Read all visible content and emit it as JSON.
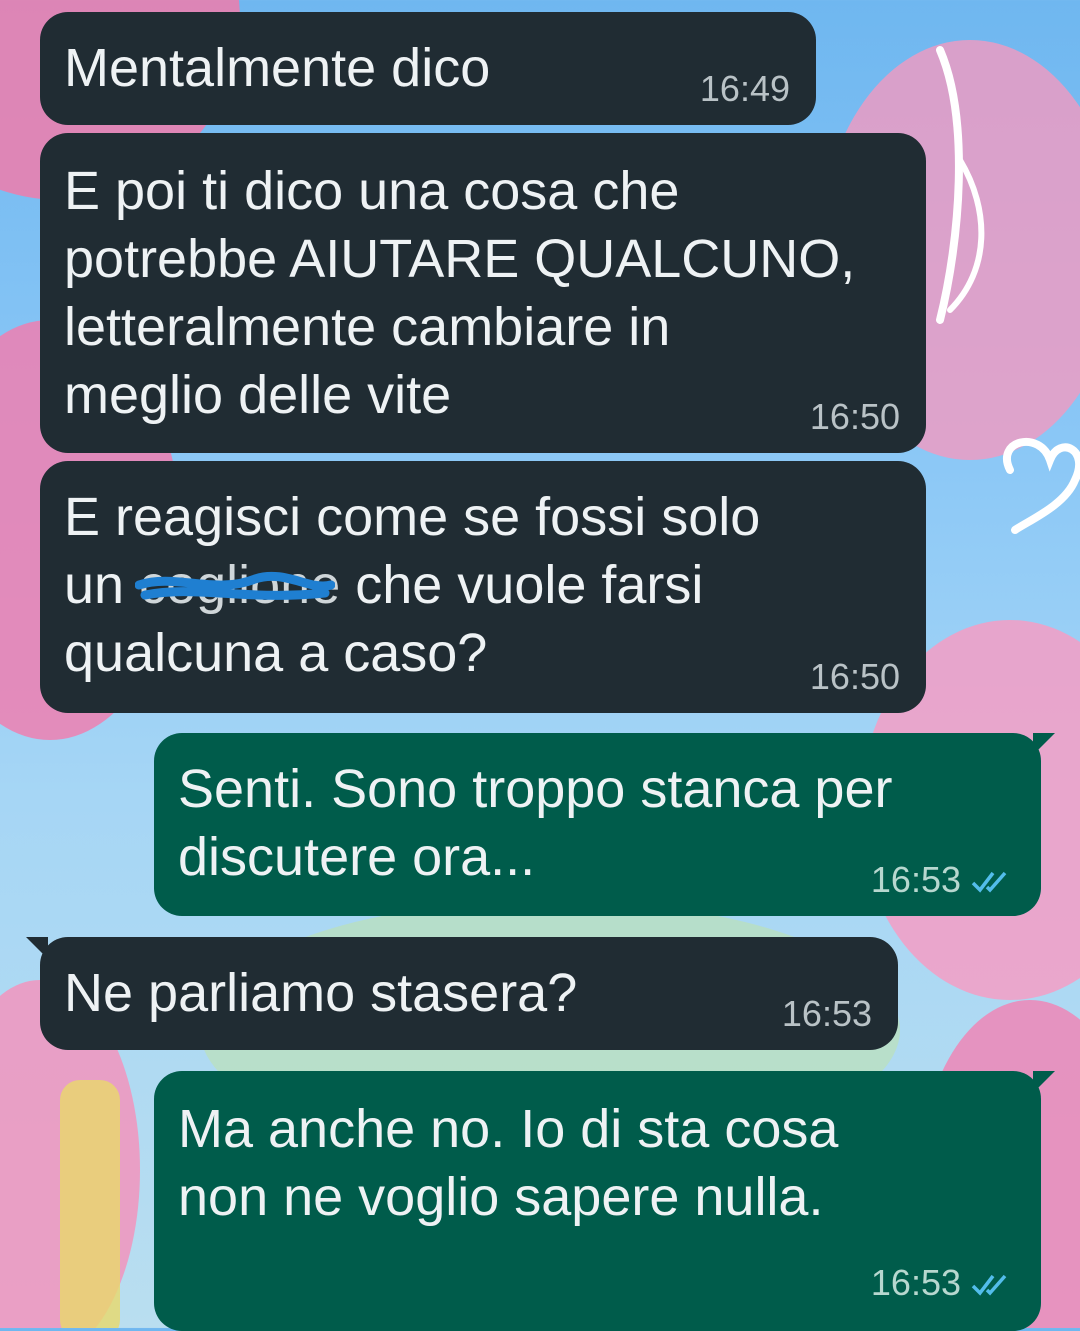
{
  "messages": [
    {
      "direction": "incoming",
      "lines": [
        "Mentalmente dico"
      ],
      "time": "16:49"
    },
    {
      "direction": "incoming",
      "lines": [
        "E poi ti dico una cosa che",
        "potrebbe AIUTARE QUALCUNO,",
        "letteralmente cambiare in",
        "meglio delle vite"
      ],
      "time": "16:50"
    },
    {
      "direction": "incoming",
      "line1": "E reagisci come se fossi solo",
      "line2_prefix": "un ",
      "line2_redacted": "coglione",
      "line2_suffix": " che vuole farsi",
      "line3": "qualcuna a caso?",
      "time": "16:50"
    },
    {
      "direction": "outgoing",
      "lines": [
        "Senti. Sono troppo stanca per",
        "discutere ora..."
      ],
      "time": "16:53",
      "status_icon": "double-check-read-icon"
    },
    {
      "direction": "incoming",
      "lines": [
        "Ne parliamo stasera?"
      ],
      "time": "16:53"
    },
    {
      "direction": "outgoing",
      "lines": [
        "Ma anche no. Io di sta cosa",
        "non ne voglio sapere nulla."
      ],
      "time": "16:53",
      "status_icon": "double-check-read-icon"
    }
  ],
  "colors": {
    "incoming_bubble": "#202c33",
    "outgoing_bubble": "#005c4b",
    "read_ticks": "#53bdeb",
    "redaction_scribble": "#1f7fd1"
  }
}
